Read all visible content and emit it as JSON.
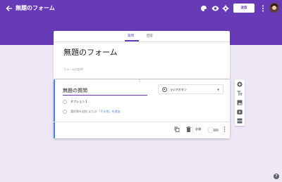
{
  "app": {
    "document_title": "無題のフォーム",
    "send_label": "送信"
  },
  "icons": {
    "back": "arrow-left-icon",
    "palette": "palette-icon",
    "preview": "eye-icon",
    "settings": "gear-icon",
    "more": "more-vert-icon",
    "help": "help-icon"
  },
  "tabs": [
    {
      "label": "質問",
      "active": true
    },
    {
      "label": "回答",
      "active": false
    }
  ],
  "form": {
    "title": "無題のフォーム",
    "description_placeholder": "フォームの説明"
  },
  "question": {
    "title": "無題の質問",
    "type_label": "ラジオボタン",
    "option_1": "オプション 1",
    "add_option": "選択肢を追加",
    "or": "または",
    "add_other": "「その他」を追加",
    "required_label": "必須",
    "required": false
  },
  "side_toolbar": [
    "add-question-icon",
    "title-text-icon",
    "image-icon",
    "video-icon",
    "section-icon"
  ],
  "colors": {
    "accent": "#673ab7",
    "background": "#ede7f6",
    "focus": "#4285f4"
  }
}
